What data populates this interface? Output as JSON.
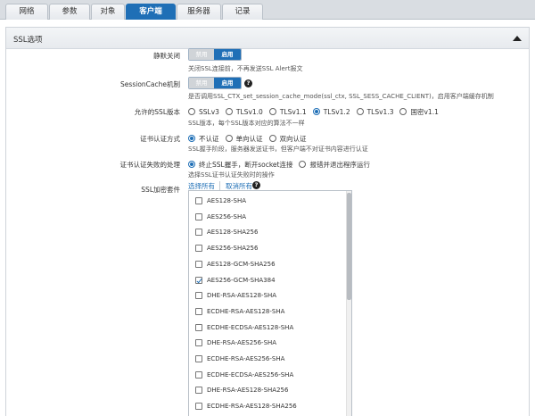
{
  "tabs": [
    {
      "label": "网络"
    },
    {
      "label": "参数"
    },
    {
      "label": "对象"
    },
    {
      "label": "客户端"
    },
    {
      "label": "服务器"
    },
    {
      "label": "记录"
    }
  ],
  "active_tab": "客户端",
  "section": {
    "title": "SSL选项"
  },
  "settings": {
    "static_close": {
      "label": "静默关闭",
      "off": "禁用",
      "on": "启用",
      "value": "启用",
      "help": "关闭SSL连接前，不再发送SSL Alert报文"
    },
    "session_cache": {
      "label": "SessionCache机制",
      "off": "禁用",
      "on": "启用",
      "value": "启用",
      "help": "是否调用SSL_CTX_set_session_cache_mode(ssl_ctx, SSL_SESS_CACHE_CLIENT)，启用客户端缓存机制"
    },
    "ssl_versions": {
      "label": "允许的SSL版本",
      "options": [
        "SSLv3",
        "TLSv1.0",
        "TLSv1.1",
        "TLSv1.2",
        "TLSv1.3",
        "国密v1.1"
      ],
      "selected": "TLSv1.2",
      "help": "SSL版本，每个SSL版本对应的算法不一样"
    },
    "cert_auth": {
      "label": "证书认证方式",
      "options": [
        "不认证",
        "单向认证",
        "双向认证"
      ],
      "selected": "不认证",
      "help": "SSL握手阶段，服务器发送证书，但客户端不对证书内容进行认证"
    },
    "cert_fail": {
      "label": "证书认证失败的处理",
      "options": [
        "终止SSL握手，断开socket连接",
        "报错并退出程序运行"
      ],
      "selected": "终止SSL握手，断开socket连接",
      "help": "选择SSL证书认证失败时的操作"
    },
    "ciphers": {
      "label": "SSL加密套件",
      "select_all": "选择所有",
      "deselect_all": "取消所有",
      "items": [
        {
          "name": "AES128-SHA",
          "checked": false
        },
        {
          "name": "AES256-SHA",
          "checked": false
        },
        {
          "name": "AES128-SHA256",
          "checked": false
        },
        {
          "name": "AES256-SHA256",
          "checked": false
        },
        {
          "name": "AES128-GCM-SHA256",
          "checked": false
        },
        {
          "name": "AES256-GCM-SHA384",
          "checked": true
        },
        {
          "name": "DHE-RSA-AES128-SHA",
          "checked": false
        },
        {
          "name": "ECDHE-RSA-AES128-SHA",
          "checked": false
        },
        {
          "name": "ECDHE-ECDSA-AES128-SHA",
          "checked": false
        },
        {
          "name": "DHE-RSA-AES256-SHA",
          "checked": false
        },
        {
          "name": "ECDHE-RSA-AES256-SHA",
          "checked": false
        },
        {
          "name": "ECDHE-ECDSA-AES256-SHA",
          "checked": false
        },
        {
          "name": "DHE-RSA-AES128-SHA256",
          "checked": false
        },
        {
          "name": "ECDHE-RSA-AES128-SHA256",
          "checked": false
        }
      ]
    }
  },
  "colors": {
    "accent": "#1f6fb6",
    "tabbar": "#d9dde2"
  }
}
